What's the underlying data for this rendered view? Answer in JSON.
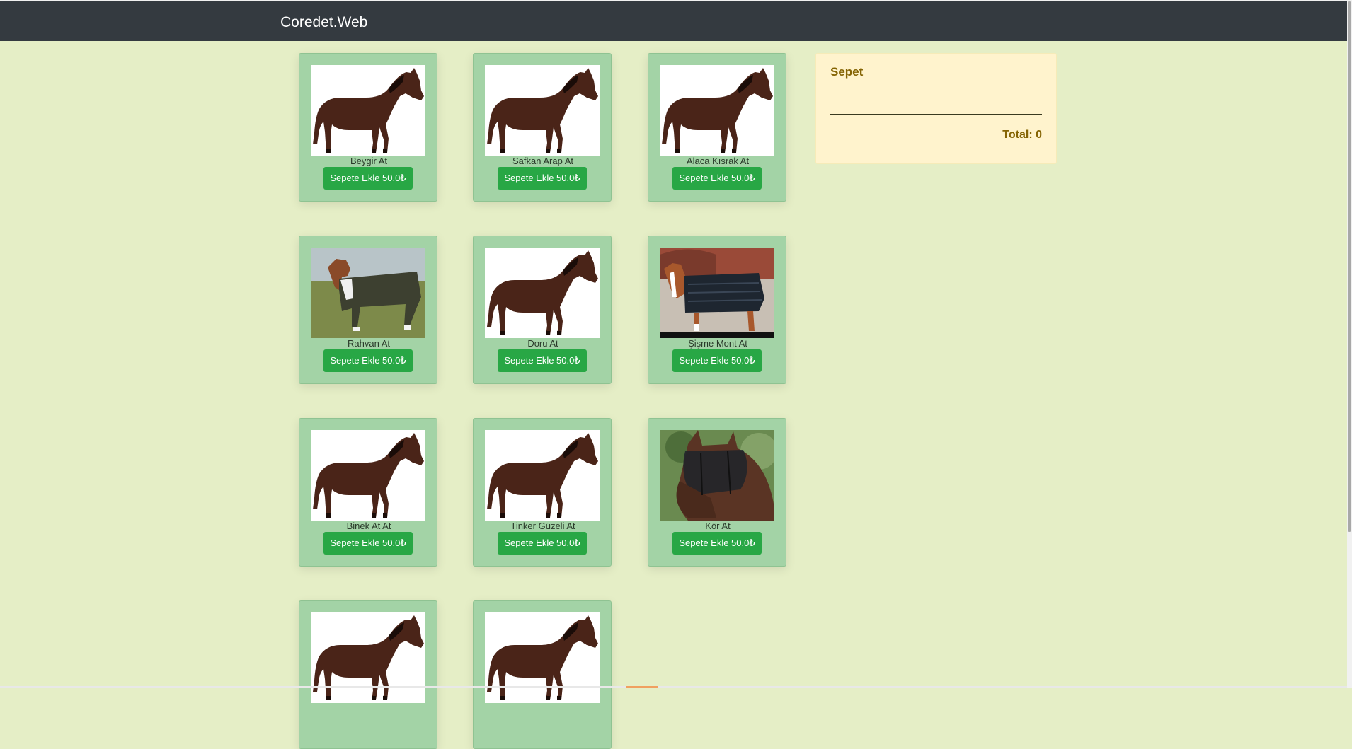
{
  "navbar": {
    "brand": "Coredet.Web"
  },
  "products": [
    {
      "name": "Beygir At",
      "button": "Sepete Ekle 50.0₺",
      "image": "bay-horse-white-bg"
    },
    {
      "name": "Safkan Arap At",
      "button": "Sepete Ekle 50.0₺",
      "image": "bay-horse-white-bg"
    },
    {
      "name": "Alaca Kısrak At",
      "button": "Sepete Ekle 50.0₺",
      "image": "bay-horse-white-bg"
    },
    {
      "name": "Rahvan At",
      "button": "Sepete Ekle 50.0₺",
      "image": "horse-in-suit-field"
    },
    {
      "name": "Doru At",
      "button": "Sepete Ekle 50.0₺",
      "image": "bay-horse-white-bg"
    },
    {
      "name": "Şişme Mont At",
      "button": "Sepete Ekle 50.0₺",
      "image": "horse-in-padded-blanket"
    },
    {
      "name": "Binek At At",
      "button": "Sepete Ekle 50.0₺",
      "image": "bay-horse-white-bg"
    },
    {
      "name": "Tinker Güzeli At",
      "button": "Sepete Ekle 50.0₺",
      "image": "bay-horse-white-bg"
    },
    {
      "name": "Kör At",
      "button": "Sepete Ekle 50.0₺",
      "image": "horse-with-fly-mask"
    },
    {
      "name": "",
      "button": "",
      "image": "bay-horse-white-bg"
    },
    {
      "name": "",
      "button": "",
      "image": "bay-horse-white-bg"
    }
  ],
  "cart": {
    "title": "Sepet",
    "total": "Total: 0"
  },
  "colors": {
    "page_bg": "#e5eec6",
    "navbar_bg": "#343a40",
    "card_bg": "#a3d3a6",
    "button_bg": "#28a745",
    "cart_bg": "#fff3cd",
    "cart_text": "#856404"
  }
}
